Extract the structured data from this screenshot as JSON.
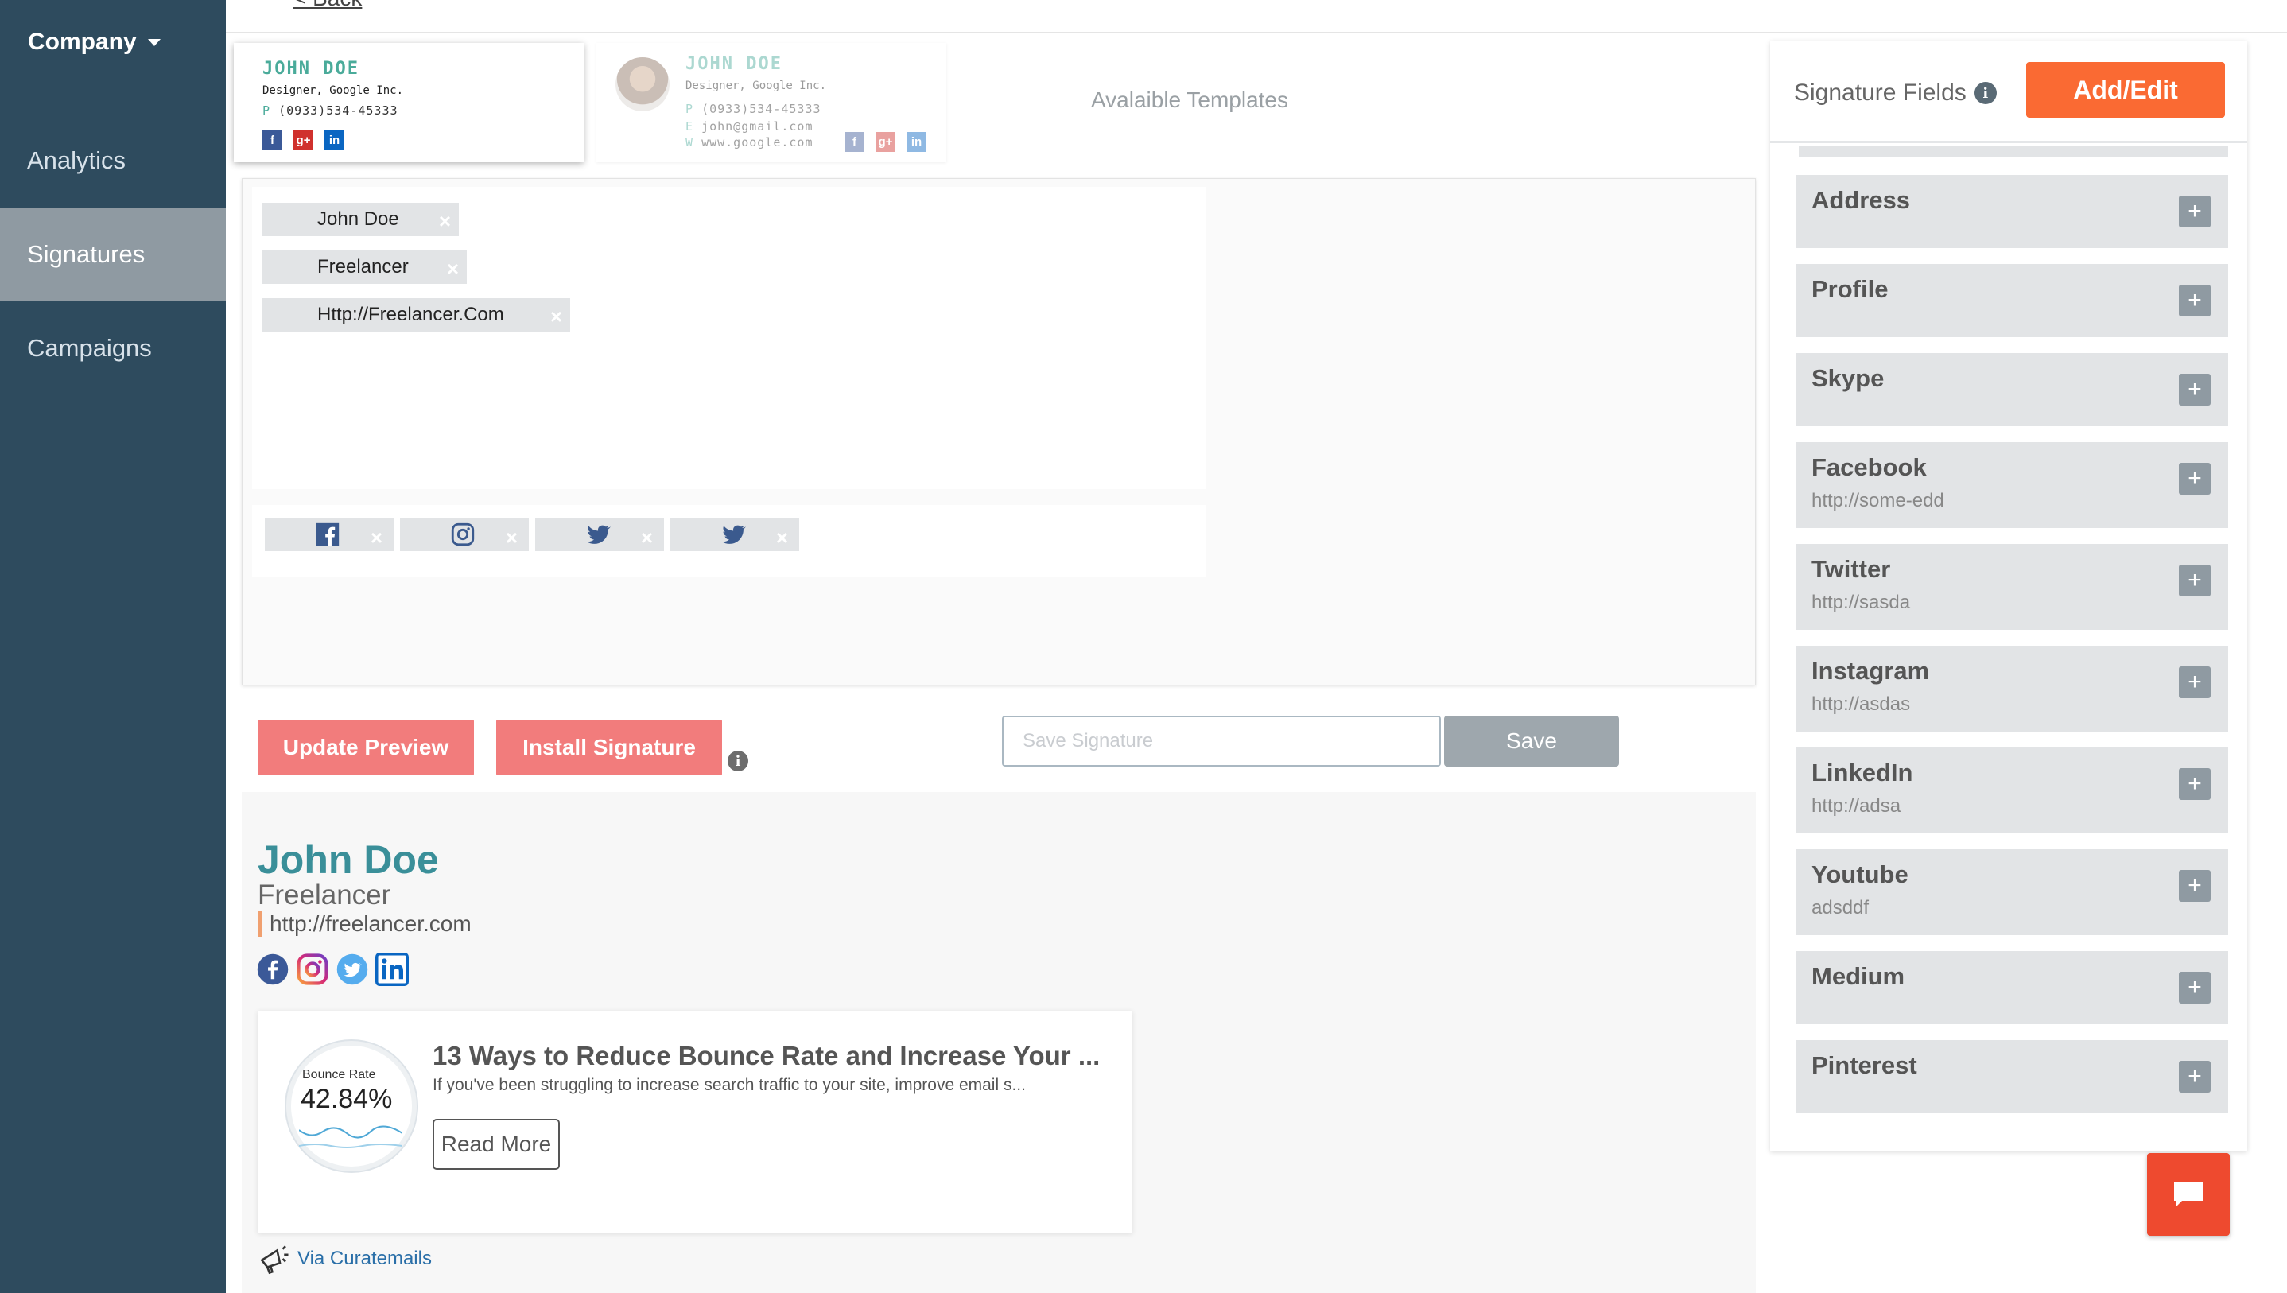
{
  "sidebar": {
    "company": "Company",
    "items": [
      {
        "label": "Analytics"
      },
      {
        "label": "Signatures",
        "active": true
      },
      {
        "label": "Campaigns"
      }
    ]
  },
  "topbar": {
    "back": "< Back"
  },
  "templates": {
    "available_label": "Avalaible Templates",
    "t1": {
      "name": "JOHN DOE",
      "title": "Designer, Google Inc.",
      "phone_prefix": "P",
      "phone": "(0933)534-45333"
    },
    "t2": {
      "name": "JOHN DOE",
      "title": "Designer, Google Inc.",
      "phone_prefix": "P",
      "phone": "(0933)534-45333",
      "email_prefix": "E",
      "email": "john@gmail.com",
      "web_prefix": "W",
      "web": "www.google.com"
    }
  },
  "editor": {
    "chips": [
      "John Doe",
      "Freelancer",
      "Http://Freelancer.Com"
    ],
    "social_chips": [
      "facebook-icon",
      "instagram-icon",
      "twitter-icon",
      "twitter-icon"
    ],
    "remove_glyph": "×"
  },
  "actions": {
    "update_preview": "Update Preview",
    "install_signature": "Install Signature",
    "info": "i",
    "save_placeholder": "Save Signature",
    "save": "Save"
  },
  "preview": {
    "name": "John Doe",
    "title": "Freelancer",
    "url": "http://freelancer.com",
    "card": {
      "image_label": "Bounce Rate",
      "image_value": "42.84%",
      "title": "13 Ways to Reduce Bounce Rate and Increase Your ...",
      "description": "If you've been struggling to increase search traffic to your site, improve email s...",
      "read_more": "Read More"
    },
    "via": "Via Curatemails"
  },
  "right_panel": {
    "title": "Signature Fields",
    "info": "i",
    "add_edit": "Add/Edit",
    "plus": "+",
    "fields": [
      {
        "name": "Address",
        "value": ""
      },
      {
        "name": "Profile",
        "value": ""
      },
      {
        "name": "Skype",
        "value": ""
      },
      {
        "name": "Facebook",
        "value": "http://some-edd"
      },
      {
        "name": "Twitter",
        "value": "http://sasda"
      },
      {
        "name": "Instagram",
        "value": "http://asdas"
      },
      {
        "name": "LinkedIn",
        "value": "http://adsa"
      },
      {
        "name": "Youtube",
        "value": "adsddf"
      },
      {
        "name": "Medium",
        "value": ""
      },
      {
        "name": "Pinterest",
        "value": ""
      }
    ]
  },
  "colors": {
    "sidebar": "#2e4b5e",
    "accent_orange": "#fa6a33",
    "accent_pink": "#f27c7c",
    "teal": "#3a8f99",
    "chat": "#ee4a2f"
  }
}
